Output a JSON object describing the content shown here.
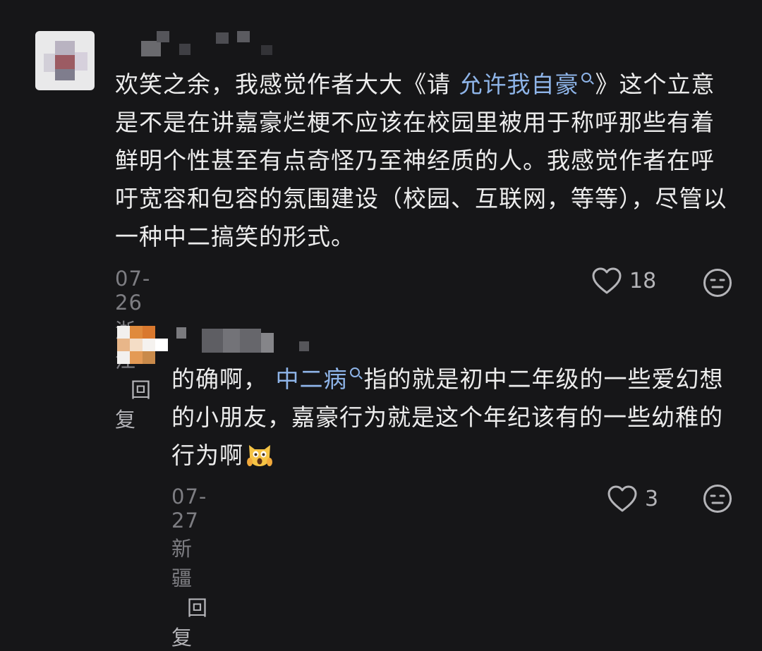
{
  "comment": {
    "text_before_tag": "欢笑之余，我感觉作者大大《请 ",
    "tag": "允许我自豪",
    "text_after_tag": "》这个立意是不是在讲嘉豪烂梗不应该在校园里被用于称呼那些有着鲜明个性甚至有点奇怪乃至神经质的人。我感觉作者在呼吁宽容和包容的氛围建设（校园、互联网，等等），尽管以一种中二搞笑的形式。",
    "date_location": "07-26 浙江",
    "reply_label": "回复",
    "like_count": "18"
  },
  "reply": {
    "text_before_tag": "的确啊，",
    "tag": "中二病",
    "text_after_tag": "指的就是初中二年级的一些爱幻想的小朋友，嘉豪行为就是这个年纪该有的一些幼稚的行为啊",
    "emoji": "scream-cat-emoji",
    "date_location": "07-27 新疆",
    "reply_label": "回复",
    "like_count": "3"
  },
  "colors": {
    "background": "#161618",
    "text": "#ececec",
    "tag": "#8eb4e8",
    "meta": "#7d7d82"
  },
  "icons": {
    "like": "heart-outline-icon",
    "dislike": "neutral-face-icon",
    "tag_search": "search-icon"
  }
}
